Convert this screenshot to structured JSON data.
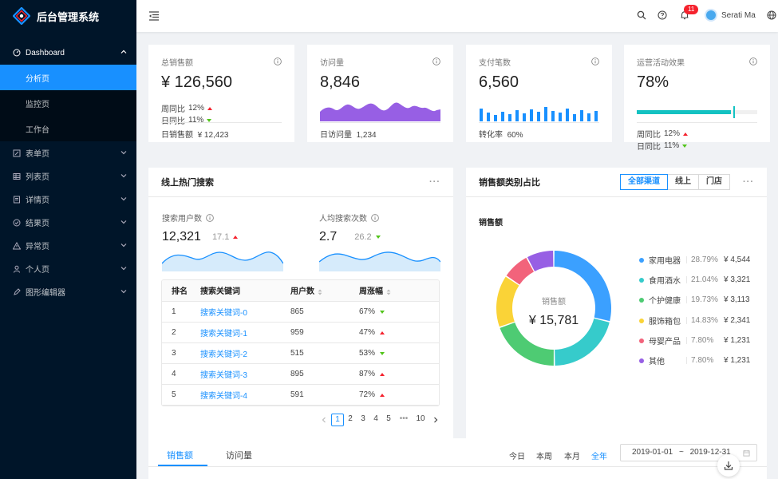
{
  "app": {
    "title": "后台管理系统"
  },
  "sidebar": {
    "items": [
      {
        "label": "Dashboard",
        "icon": "dashboard-icon",
        "open": true
      },
      {
        "label": "表单页",
        "icon": "form-icon"
      },
      {
        "label": "列表页",
        "icon": "table-icon"
      },
      {
        "label": "详情页",
        "icon": "profile-icon"
      },
      {
        "label": "结果页",
        "icon": "check-circle-icon"
      },
      {
        "label": "异常页",
        "icon": "warning-icon"
      },
      {
        "label": "个人页",
        "icon": "user-icon"
      },
      {
        "label": "图形编辑器",
        "icon": "highlight-icon"
      }
    ],
    "dashboard_children": [
      {
        "label": "分析页",
        "active": true
      },
      {
        "label": "监控页"
      },
      {
        "label": "工作台"
      }
    ]
  },
  "header": {
    "notification_count": "11",
    "user_name": "Serati Ma"
  },
  "stats": [
    {
      "title": "总销售额",
      "value": "¥ 126,560",
      "week_label": "周同比",
      "week_value": "12%",
      "day_label": "日同比",
      "day_value": "11%",
      "footer_label": "日销售额",
      "footer_value": "¥ 12,423"
    },
    {
      "title": "访问量",
      "value": "8,846",
      "footer_label": "日访问量",
      "footer_value": "1,234"
    },
    {
      "title": "支付笔数",
      "value": "6,560",
      "footer_label": "转化率",
      "footer_value": "60%"
    },
    {
      "title": "运营活动效果",
      "value": "78%",
      "progress": 0.78,
      "target": 0.8,
      "week_label": "周同比",
      "week_value": "12%",
      "day_label": "日同比",
      "day_value": "11%"
    }
  ],
  "search_panel": {
    "title": "线上热门搜索",
    "users_label": "搜索用户数",
    "users_value": "12,321",
    "users_change": "17.1",
    "avg_label": "人均搜索次数",
    "avg_value": "2.7",
    "avg_change": "26.2",
    "table": {
      "headers": [
        "排名",
        "搜索关键词",
        "用户数",
        "周涨幅"
      ],
      "rows": [
        {
          "rank": "1",
          "keyword": "搜索关键词-0",
          "count": "865",
          "range": "67%",
          "trend": "down"
        },
        {
          "rank": "2",
          "keyword": "搜索关键词-1",
          "count": "959",
          "range": "47%",
          "trend": "up"
        },
        {
          "rank": "3",
          "keyword": "搜索关键词-2",
          "count": "515",
          "range": "53%",
          "trend": "down"
        },
        {
          "rank": "4",
          "keyword": "搜索关键词-3",
          "count": "895",
          "range": "87%",
          "trend": "up"
        },
        {
          "rank": "5",
          "keyword": "搜索关键词-4",
          "count": "591",
          "range": "72%",
          "trend": "up"
        }
      ]
    },
    "pager": {
      "pages": [
        "1",
        "2",
        "3",
        "4",
        "5"
      ],
      "ellipsis": "•••",
      "last": "10"
    }
  },
  "pie_panel": {
    "title": "销售额类别占比",
    "segments": [
      "全部渠道",
      "线上",
      "门店"
    ],
    "subtitle": "销售额",
    "center_label": "销售额",
    "center_value": "¥ 15,781"
  },
  "chart_data": {
    "type": "pie",
    "title": "销售额",
    "categories": [
      "家用电器",
      "食用酒水",
      "个护健康",
      "服饰箱包",
      "母婴产品",
      "其他"
    ],
    "percents": [
      "28.79%",
      "21.04%",
      "19.73%",
      "14.83%",
      "7.80%",
      "7.80%"
    ],
    "amounts": [
      "¥ 4,544",
      "¥ 3,321",
      "¥ 3,113",
      "¥ 2,341",
      "¥ 1,231",
      "¥ 1,231"
    ],
    "values": [
      4544,
      3321,
      3113,
      2341,
      1231,
      1231
    ],
    "colors": [
      "#3ba0ff",
      "#36cbcb",
      "#4ecb73",
      "#fad337",
      "#f2637b",
      "#975fe4"
    ]
  },
  "bottom": {
    "tabs": [
      "销售额",
      "访问量"
    ],
    "ranges": [
      "今日",
      "本周",
      "本月",
      "全年"
    ],
    "date_start": "2019-01-01",
    "date_sep": "~",
    "date_end": "2019-12-31"
  },
  "colors": {
    "primary": "#1890ff",
    "sidebar": "#001529",
    "up": "#f5222d",
    "down": "#52c41a"
  }
}
